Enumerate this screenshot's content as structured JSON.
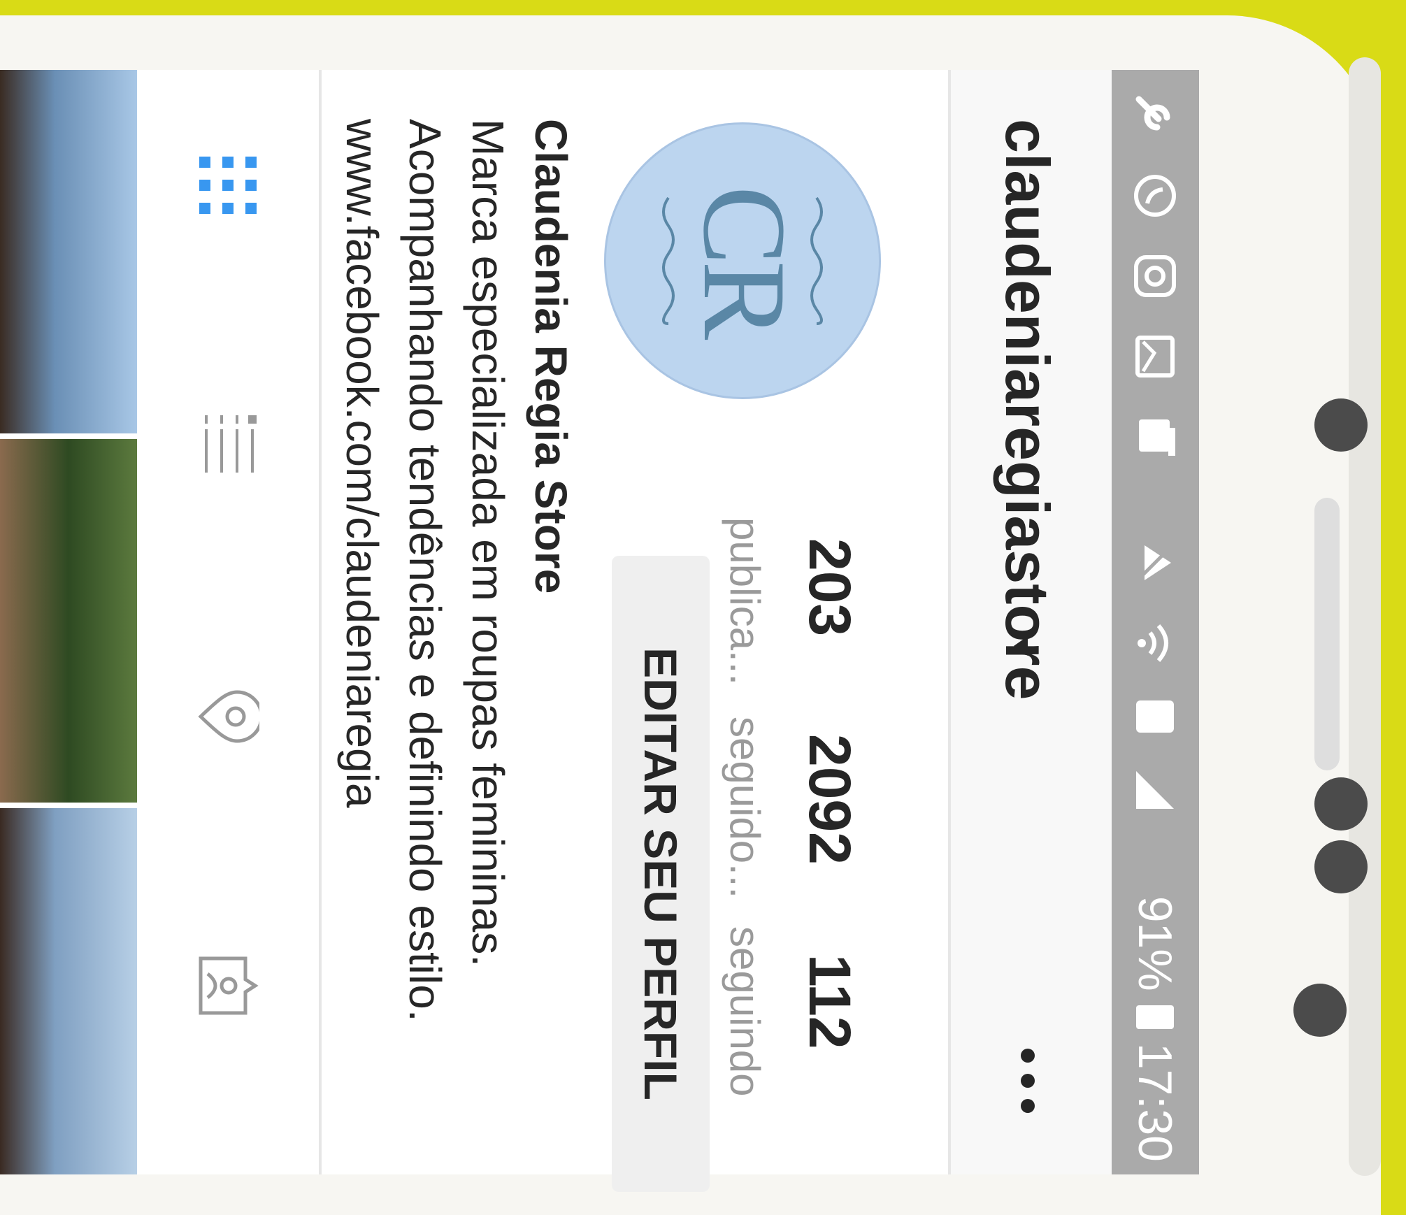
{
  "status_bar": {
    "battery_percent": "91%",
    "time": "17:30",
    "icons": [
      "wrench-icon",
      "whatsapp-icon",
      "instagram-icon",
      "gallery-icon",
      "notification-icon",
      "mute-icon",
      "wifi-icon",
      "sim-icon",
      "signal-icon",
      "battery-icon"
    ]
  },
  "header": {
    "username": "claudeniaregiastore",
    "dropdown_icon": "caret-down-icon",
    "menu_icon": "more-options-icon"
  },
  "profile": {
    "avatar_monogram": "CR",
    "stats": [
      {
        "value": "203",
        "label": "publica..."
      },
      {
        "value": "2092",
        "label": "seguido..."
      },
      {
        "value": "112",
        "label": "seguindo"
      }
    ],
    "edit_button_label": "EDITAR SEU PERFIL",
    "display_name": "Claudenia Regia Store",
    "bio_lines": [
      "Marca especializada em roupas femininas.",
      "Acompanhando tendências e definindo estilo.",
      "www.facebook.com/claudeniaregia"
    ]
  },
  "tabs": [
    {
      "name": "grid",
      "icon": "grid-icon",
      "active": true
    },
    {
      "name": "list",
      "icon": "list-icon",
      "active": false
    },
    {
      "name": "location",
      "icon": "location-pin-icon",
      "active": false
    },
    {
      "name": "tagged",
      "icon": "tagged-person-icon",
      "active": false
    }
  ],
  "colors": {
    "background": "#d9db16",
    "status_bar": "#aaaaaa",
    "avatar": "#bcd5ef",
    "active_tab": "#3897f0"
  }
}
